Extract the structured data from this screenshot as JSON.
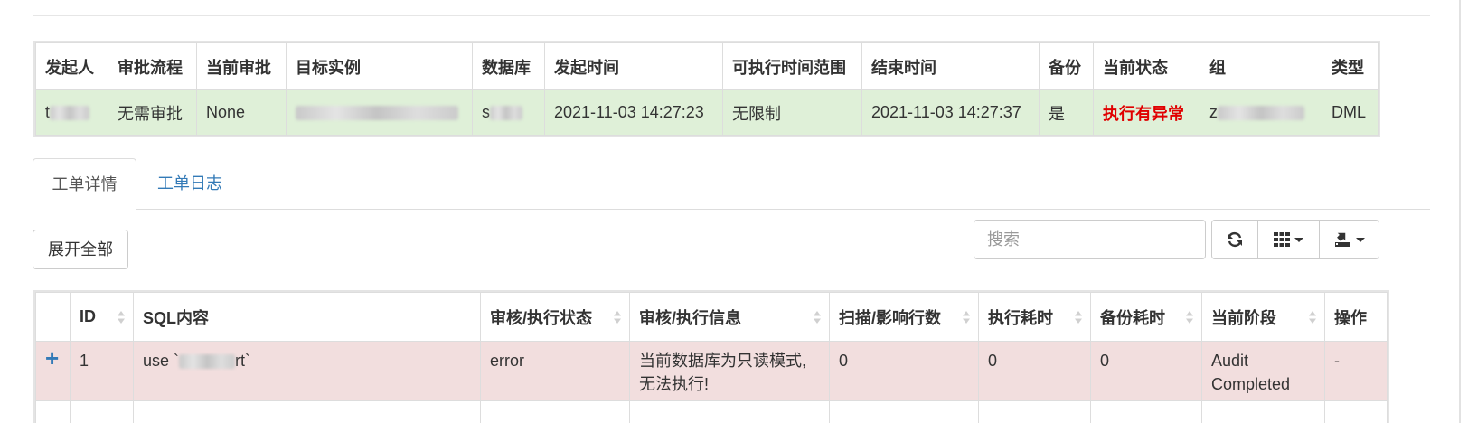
{
  "summary": {
    "headers": [
      "发起人",
      "审批流程",
      "当前审批",
      "目标实例",
      "数据库",
      "发起时间",
      "可执行时间范围",
      "结束时间",
      "备份",
      "当前状态",
      "组",
      "类型"
    ],
    "row": {
      "initiator_prefix": "t",
      "workflow": "无需审批",
      "current_approval": "None",
      "database_prefix": "s",
      "start_time": "2021-11-03 14:27:23",
      "exec_window": "无限制",
      "end_time": "2021-11-03 14:27:37",
      "backup": "是",
      "status": "执行有异常",
      "group_prefix": "z",
      "type": "DML"
    },
    "status_color": "#e00000",
    "row_color": "#dff0d8"
  },
  "tabs": [
    {
      "label": "工单详情",
      "active": true
    },
    {
      "label": "工单日志",
      "active": false
    }
  ],
  "toolbar": {
    "expand_label": "展开全部",
    "search_placeholder": "搜索",
    "icons": [
      "refresh-icon",
      "columns-icon",
      "export-icon"
    ]
  },
  "detail": {
    "headers": [
      "ID",
      "SQL内容",
      "审核/执行状态",
      "审核/执行信息",
      "扫描/影响行数",
      "执行耗时",
      "备份耗时",
      "当前阶段",
      "操作"
    ],
    "rows": [
      {
        "id": "1",
        "sql_prefix": "use `",
        "sql_suffix": "rt`",
        "status": "error",
        "message": "当前数据库为只读模式,无法执行!",
        "affected_rows": "0",
        "exec_time": "0",
        "backup_time": "0",
        "stage": "Audit Completed",
        "action": "-"
      }
    ],
    "row_color": "#f2dede"
  },
  "colors": {
    "link": "#337ab7",
    "border": "#dddddd"
  }
}
